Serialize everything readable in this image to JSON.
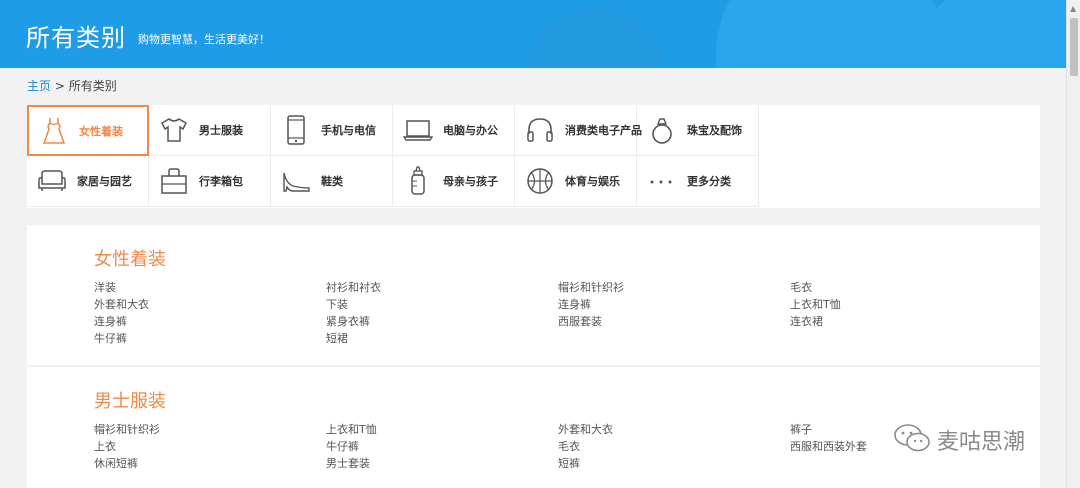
{
  "header": {
    "title": "所有类别",
    "slogan": "购物更智慧，生活更美好！"
  },
  "breadcrumb": {
    "home": "主页",
    "separator": " > ",
    "current": "所有类别"
  },
  "categories": [
    {
      "label": "女性着装",
      "icon": "dress-icon",
      "active": true
    },
    {
      "label": "男士服装",
      "icon": "tshirt-icon"
    },
    {
      "label": "手机与电信",
      "icon": "phone-icon"
    },
    {
      "label": "电脑与办公",
      "icon": "laptop-icon"
    },
    {
      "label": "消费类电子产品",
      "icon": "headphones-icon"
    },
    {
      "label": "珠宝及配饰",
      "icon": "ring-icon"
    },
    {
      "label": "家居与园艺",
      "icon": "sofa-icon"
    },
    {
      "label": "行李箱包",
      "icon": "bag-icon"
    },
    {
      "label": "鞋类",
      "icon": "high-heel-icon"
    },
    {
      "label": "母亲与孩子",
      "icon": "baby-bottle-icon"
    },
    {
      "label": "体育与娱乐",
      "icon": "basketball-icon"
    },
    {
      "label": "更多分类",
      "icon": "more-dots-icon"
    }
  ],
  "sections": [
    {
      "title": "女性着装",
      "items": [
        "洋装",
        "衬衫和衬衣",
        "帽衫和针织衫",
        "毛衣",
        "外套和大衣",
        "下装",
        "连身裤",
        "上衣和T恤",
        "连身裤",
        "紧身衣裤",
        "西服套装",
        "连衣裙",
        "牛仔裤",
        "短裙"
      ]
    },
    {
      "title": "男士服装",
      "items": [
        "帽衫和针织衫",
        "上衣和T恤",
        "外套和大衣",
        "裤子",
        "上衣",
        "牛仔裤",
        "毛衣",
        "西服和西装外套",
        "休闲短裤",
        "男士套装",
        "短裤"
      ]
    }
  ],
  "watermark": {
    "text": "麦咕思潮",
    "icon": "wechat-icon"
  },
  "colors": {
    "header": "#1e9ce5",
    "accent": "#f08a4b",
    "link": "#1e88d0"
  }
}
